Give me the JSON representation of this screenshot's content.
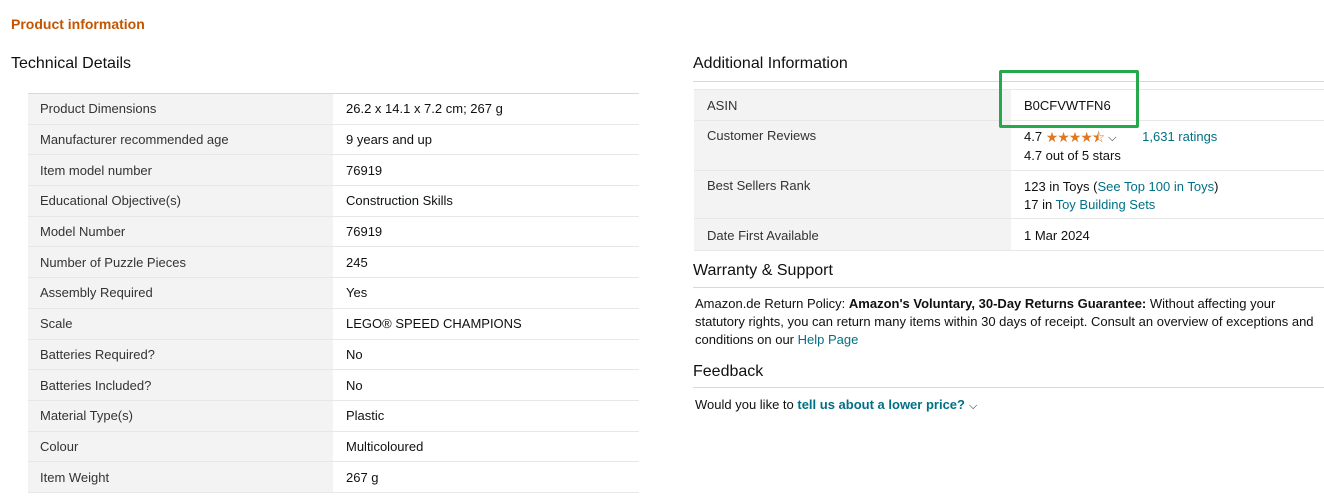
{
  "product_information": {
    "title": "Product information"
  },
  "technical_details": {
    "heading": "Technical Details",
    "rows": [
      {
        "label": "Product Dimensions",
        "value": "26.2 x 14.1 x 7.2 cm; 267 g"
      },
      {
        "label": "Manufacturer recommended age",
        "value": "9 years and up"
      },
      {
        "label": "Item model number",
        "value": "76919"
      },
      {
        "label": "Educational Objective(s)",
        "value": "Construction Skills"
      },
      {
        "label": "Model Number",
        "value": "76919"
      },
      {
        "label": "Number of Puzzle Pieces",
        "value": "245"
      },
      {
        "label": "Assembly Required",
        "value": "Yes"
      },
      {
        "label": "Scale",
        "value": "LEGO® SPEED CHAMPIONS"
      },
      {
        "label": "Batteries Required?",
        "value": "No"
      },
      {
        "label": "Batteries Included?",
        "value": "No"
      },
      {
        "label": "Material Type(s)",
        "value": "Plastic"
      },
      {
        "label": "Colour",
        "value": "Multicoloured"
      },
      {
        "label": "Item Weight",
        "value": "267 g"
      }
    ]
  },
  "additional_information": {
    "heading": "Additional Information",
    "asin": {
      "label": "ASIN",
      "value": "B0CFVWTFN6"
    },
    "customer_reviews": {
      "label": "Customer Reviews",
      "rating": "4.7",
      "stars": "★★★★⯪",
      "ratings_count": "1,631 ratings",
      "out_of": "4.7 out of 5 stars"
    },
    "best_sellers_rank": {
      "label": "Best Sellers Rank",
      "line1_prefix": "123 in Toys (",
      "line1_link": "See Top 100 in Toys",
      "line1_suffix": ")",
      "line2_prefix": "17 in ",
      "line2_link": "Toy Building Sets"
    },
    "date_first_available": {
      "label": "Date First Available",
      "value": "1 Mar 2024"
    }
  },
  "warranty": {
    "heading": "Warranty & Support",
    "policy_prefix": "Amazon.de Return Policy: ",
    "policy_bold": "Amazon's Voluntary, 30-Day Returns Guarantee:",
    "policy_text": " Without affecting your statutory rights, you can return many items within 30 days of receipt. Consult an overview of exceptions and conditions on our ",
    "help_link": "Help Page"
  },
  "feedback": {
    "heading": "Feedback",
    "prompt": "Would you like to ",
    "link": "tell us about a lower price?"
  },
  "colors": {
    "section_title": "#c45500",
    "link": "#007185",
    "star": "#de7921",
    "highlight": "#25a94c"
  }
}
